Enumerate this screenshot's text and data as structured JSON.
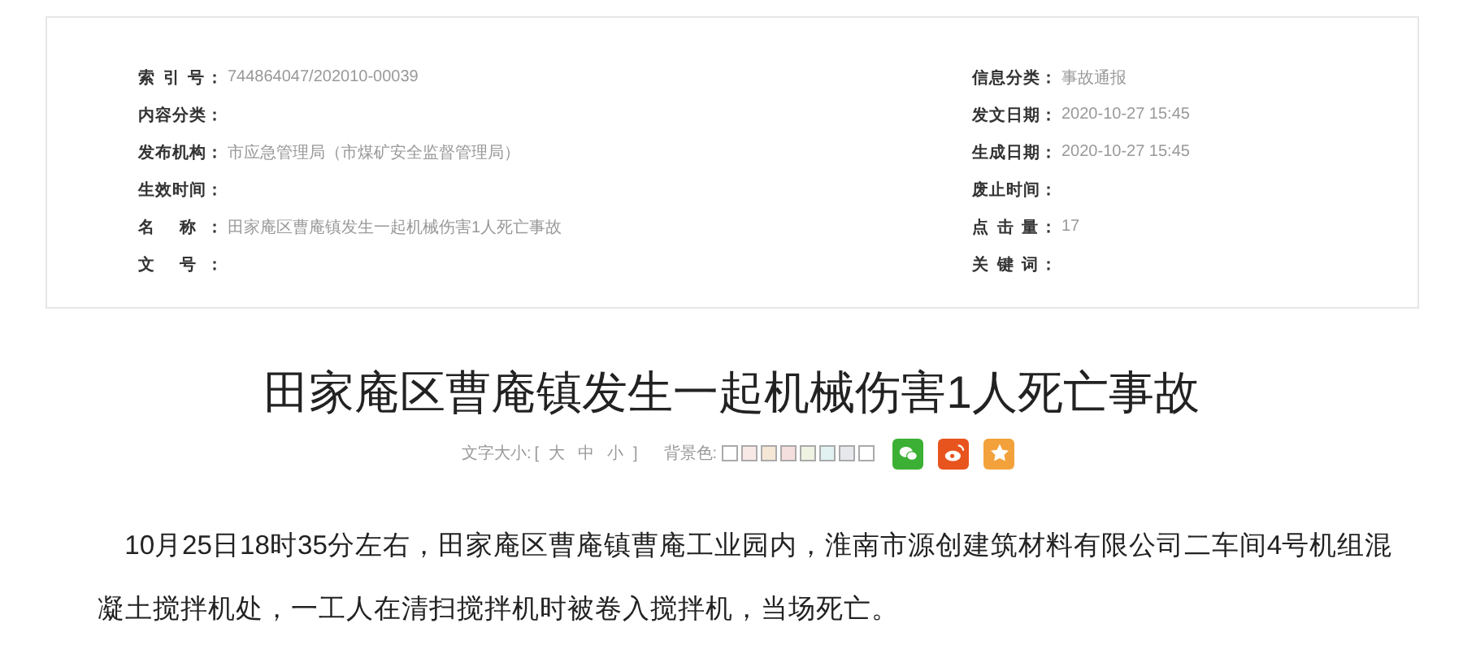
{
  "meta": {
    "left": [
      {
        "label": "索 引 号：",
        "value": "744864047/202010-00039"
      },
      {
        "label": "内容分类："
      },
      {
        "label": "发布机构：",
        "value": "市应急管理局（市煤矿安全监督管理局）"
      },
      {
        "label": "生效时间："
      },
      {
        "label": "名 称：",
        "value": "田家庵区曹庵镇发生一起机械伤害1人死亡事故"
      },
      {
        "label": "文 号："
      }
    ],
    "right": [
      {
        "label": "信息分类：",
        "value": "事故通报"
      },
      {
        "label": "发文日期：",
        "value": "2020-10-27 15:45"
      },
      {
        "label": "生成日期：",
        "value": "2020-10-27 15:45"
      },
      {
        "label": "废止时间："
      },
      {
        "label": "点 击 量：",
        "value": "17"
      },
      {
        "label": "关 键 词："
      }
    ]
  },
  "title": "田家庵区曹庵镇发生一起机械伤害1人死亡事故",
  "toolbar": {
    "font_label": "文字大小:",
    "open_bracket": "[",
    "sizes": [
      "大",
      "中",
      "小"
    ],
    "close_bracket": "]",
    "bg_label": "背景色:",
    "swatches": [
      {
        "color": "#ffffff"
      },
      {
        "color": "#f9e9e6"
      },
      {
        "color": "#f6e6d6"
      },
      {
        "color": "#f5dede"
      },
      {
        "color": "#eef3e2"
      },
      {
        "color": "#e2f2f2"
      },
      {
        "color": "#e6e8ec"
      },
      {
        "color": "#ffffff"
      }
    ],
    "share": [
      {
        "kind": "wechat"
      },
      {
        "kind": "weibo"
      },
      {
        "kind": "favorite"
      }
    ]
  },
  "body": "10月25日18时35分左右，田家庵区曹庵镇曹庵工业园内，淮南市源创建筑材料有限公司二车间4号机组混凝土搅拌机处，一工人在清扫搅拌机时被卷入搅拌机，当场死亡。"
}
